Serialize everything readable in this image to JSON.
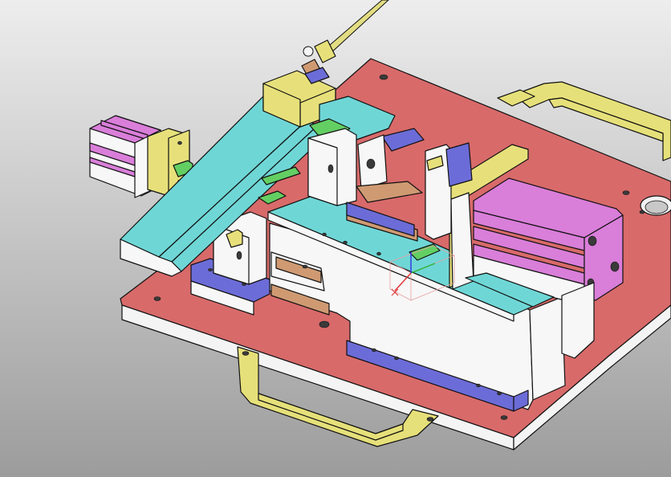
{
  "viewport": {
    "background_top": "#ededed",
    "background_bottom": "#9c9c9c"
  },
  "colors": {
    "base_plate": "#d86a6a",
    "base_plate_side": "#f4f4f4",
    "handle": "#e6e07a",
    "block_white": "#f7f7f7",
    "teal": "#6fd6d6",
    "magenta": "#d97ed9",
    "yellow": "#e7e07a",
    "blue_violet": "#6c6cd8",
    "green": "#63cf63",
    "orange": "#cf9a72",
    "cable": "#e2dd82",
    "axis_x": "#e03030",
    "axis_y": "#30b030",
    "axis_z": "#3030e0"
  },
  "model": {
    "parts": [
      "base-plate",
      "front-handle",
      "rear-handle",
      "left-cylinder",
      "right-cylinder",
      "teal-slide-rail",
      "center-support",
      "cable-connector",
      "coordinate-triad"
    ]
  }
}
